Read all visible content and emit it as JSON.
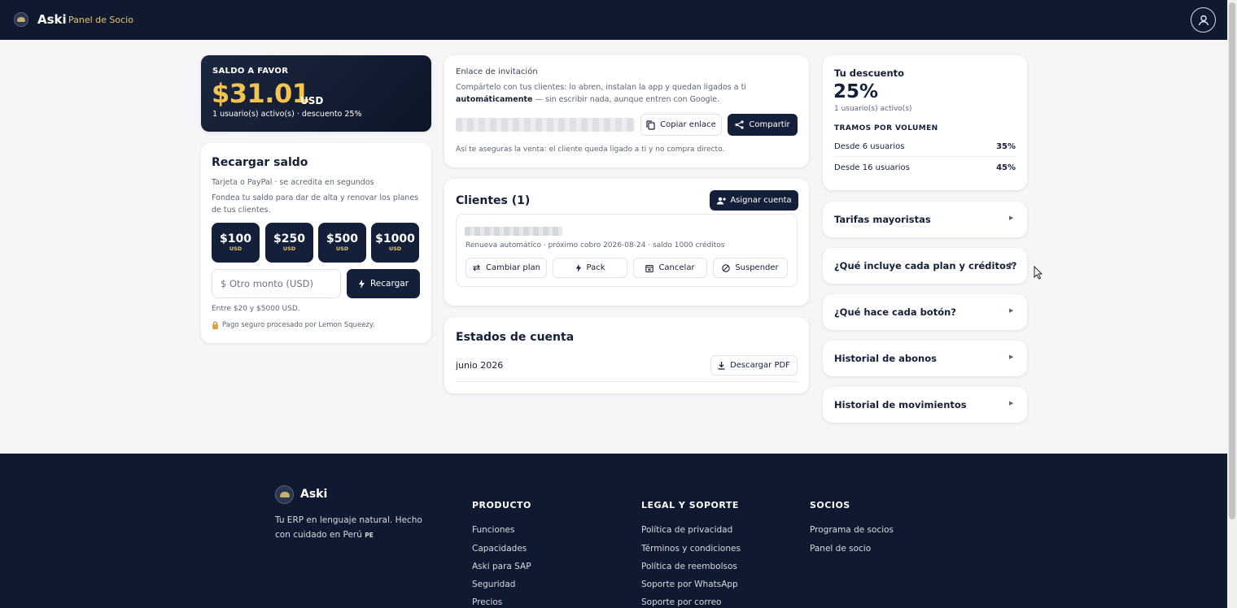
{
  "header": {
    "brand": "Aski",
    "subtitle": "Panel de Socio"
  },
  "balance": {
    "label": "SALDO A FAVOR",
    "amount": "$31.01",
    "currency": "USD",
    "detail": "1 usuario(s) activo(s) · descuento 25%"
  },
  "recharge": {
    "title": "Recargar saldo",
    "methods": "Tarjeta o PayPal · se acredita en segundos",
    "description": "Fondea tu saldo para dar de alta y renovar los planes de tus clientes.",
    "amounts": [
      {
        "value": "$100",
        "unit": "USD"
      },
      {
        "value": "$250",
        "unit": "USD"
      },
      {
        "value": "$500",
        "unit": "USD"
      },
      {
        "value": "$1000",
        "unit": "USD"
      }
    ],
    "other_placeholder": "$ Otro monto (USD)",
    "recargar_label": "Recargar",
    "range": "Entre $20 y $5000 USD.",
    "secure": "Pago seguro procesado por Lemon Squeezy."
  },
  "invite": {
    "title": "Enlace de invitación",
    "desc_before": "Compártelo con tus clientes: lo abren, instalan la app y quedan ligados a ti ",
    "desc_bold": "automáticamente",
    "desc_after": " — sin escribir nada, aunque entren con Google.",
    "copy_label": "Copiar enlace",
    "share_label": "Compartir",
    "note": "Así te aseguras la venta: el cliente queda ligado a ti y no compra directo."
  },
  "clients": {
    "title": "Clientes (1)",
    "assign_label": "Asignar cuenta",
    "rows": [
      {
        "meta": "Renueva automático · próximo cobro 2026-08-24 · saldo 1000 créditos",
        "actions": [
          "Cambiar plan",
          "Pack",
          "Cancelar",
          "Suspender"
        ]
      }
    ]
  },
  "statements": {
    "title": "Estados de cuenta",
    "month": "junio 2026",
    "download_label": "Descargar PDF"
  },
  "discount": {
    "title": "Tu descuento",
    "percent": "25%",
    "active": "1 usuario(s) activo(s)",
    "tiers_title": "TRAMOS POR VOLUMEN",
    "tiers": [
      {
        "label": "Desde 6 usuarios",
        "value": "35%"
      },
      {
        "label": "Desde 16 usuarios",
        "value": "45%"
      }
    ]
  },
  "accordions": [
    "Tarifas mayoristas",
    "¿Qué incluye cada plan y créditos?",
    "¿Qué hace cada botón?",
    "Historial de abonos",
    "Historial de movimientos"
  ],
  "footer": {
    "brand": "Aski",
    "tagline": "Tu ERP en lenguaje natural. Hecho con cuidado en Perú",
    "country_code": "PE",
    "columns": [
      {
        "title": "PRODUCTO",
        "links": [
          "Funciones",
          "Capacidades",
          "Aski para SAP",
          "Seguridad",
          "Precios"
        ]
      },
      {
        "title": "LEGAL Y SOPORTE",
        "links": [
          "Política de privacidad",
          "Términos y condiciones",
          "Política de reembolsos",
          "Soporte por WhatsApp",
          "Soporte por correo"
        ]
      },
      {
        "title": "SOCIOS",
        "links": [
          "Programa de socios",
          "Panel de socio"
        ]
      }
    ]
  },
  "colors": {
    "navy": "#0f1a30",
    "accent_gold": "#f3c54e",
    "button_dark": "#14203a"
  }
}
